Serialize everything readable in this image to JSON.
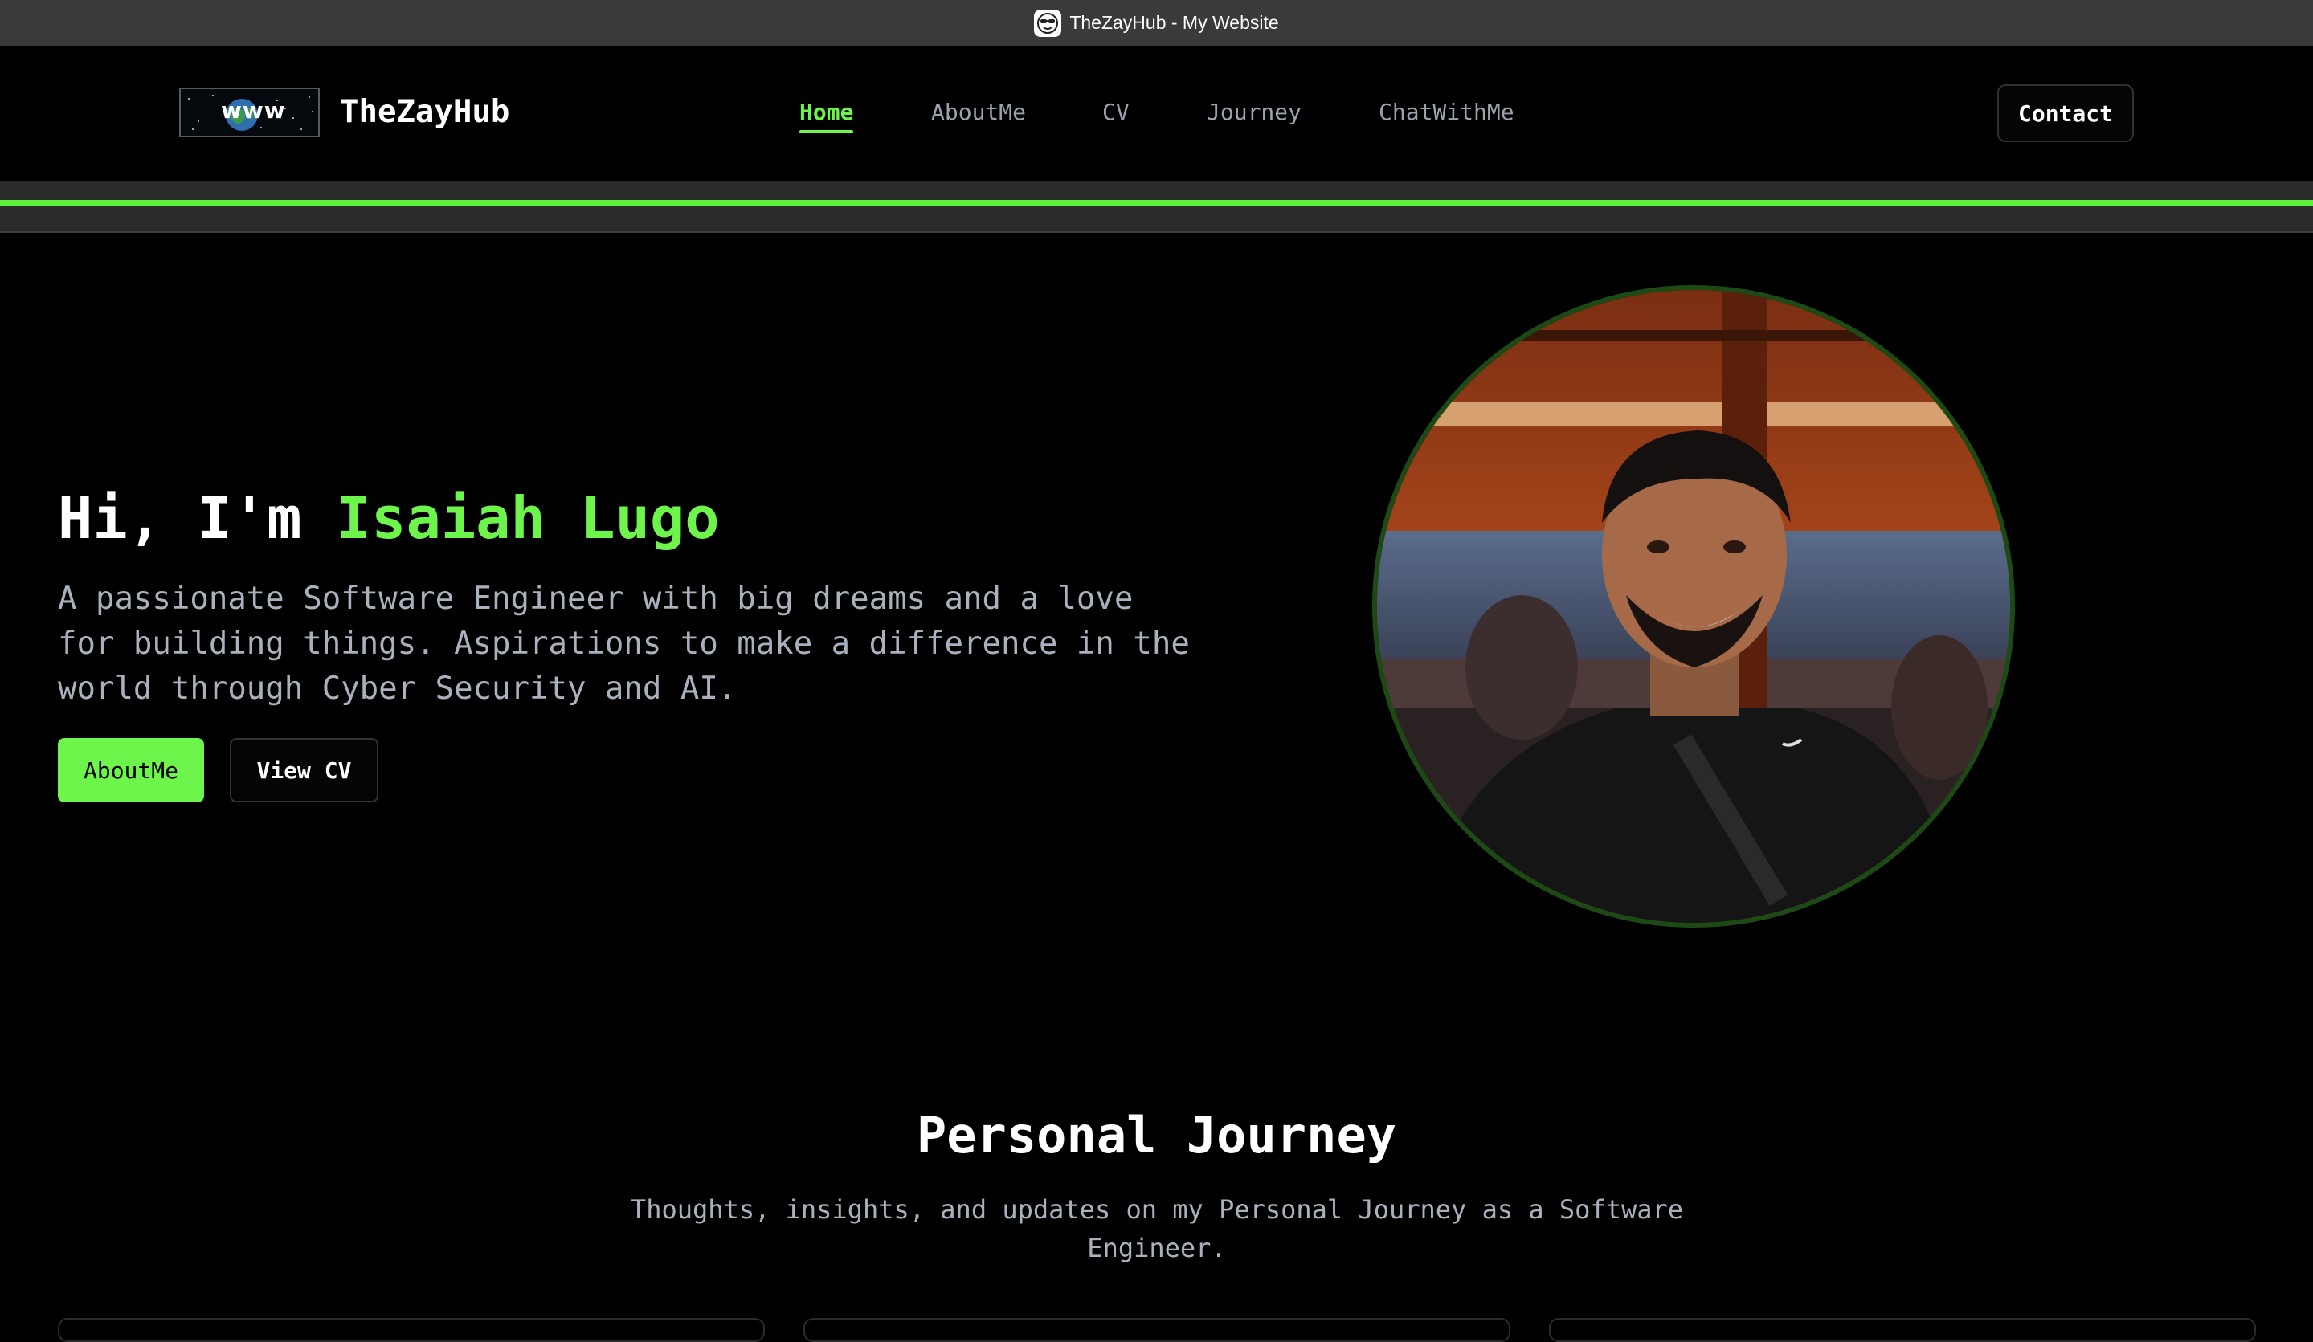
{
  "window": {
    "tab_title": "TheZayHub - My Website",
    "favicon_icon": "sunglasses-face-icon"
  },
  "navbar": {
    "logo_text": "www",
    "brand": "TheZayHub",
    "links": [
      {
        "label": "Home",
        "active": true
      },
      {
        "label": "AboutMe",
        "active": false
      },
      {
        "label": "CV",
        "active": false
      },
      {
        "label": "Journey",
        "active": false
      },
      {
        "label": "ChatWithMe",
        "active": false
      }
    ],
    "contact_label": "Contact"
  },
  "scroll_progress": 1.0,
  "hero": {
    "greeting": "Hi, I'm ",
    "name": "Isaiah Lugo",
    "description": "A passionate Software Engineer with big dreams and a love for building things. Aspirations to make a difference in the world through Cyber Security and AI.",
    "primary_button": "AboutMe",
    "secondary_button": "View CV"
  },
  "journey": {
    "title": "Personal Journey",
    "subtitle": "Thoughts, insights, and updates on my Personal Journey as a Software Engineer."
  },
  "colors": {
    "accent": "#6ef54c",
    "background": "#000000",
    "muted_text": "#a9b1bd"
  }
}
